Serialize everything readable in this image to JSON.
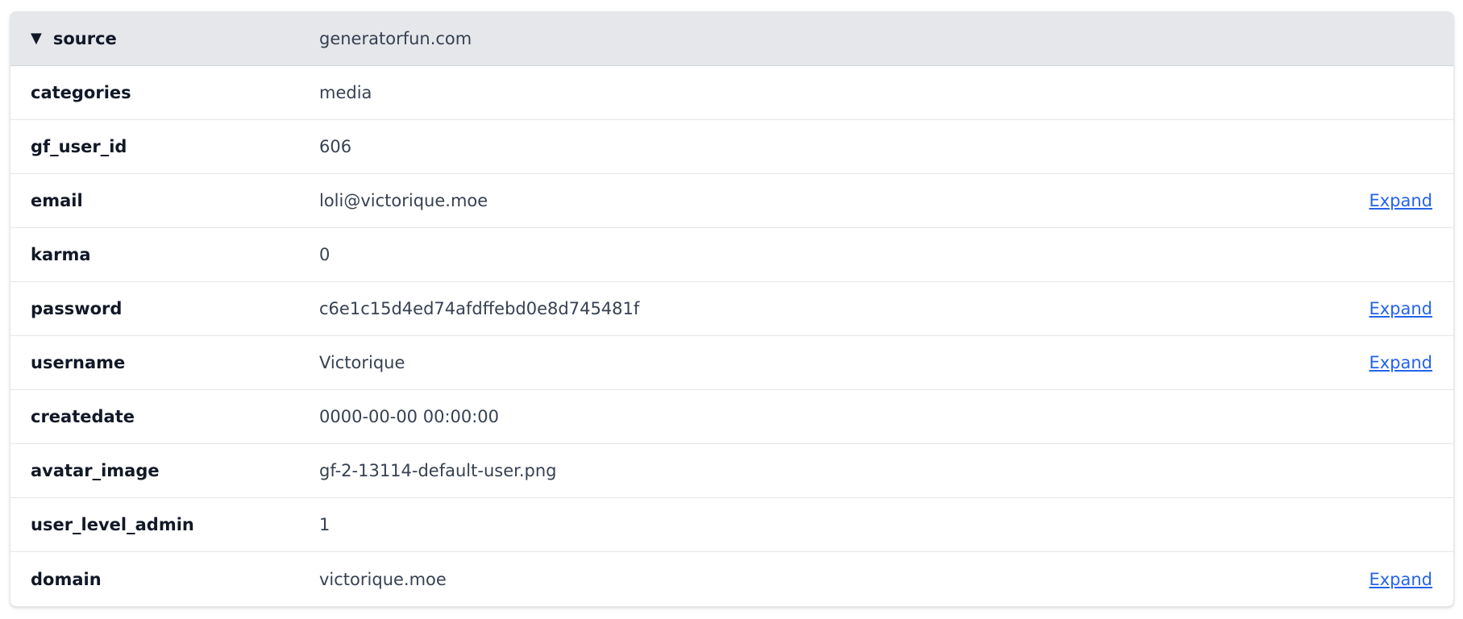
{
  "header": {
    "caret_icon": "▼",
    "key": "source",
    "value": "generatorfun.com"
  },
  "rows": [
    {
      "key": "categories",
      "value": "media",
      "expand": ""
    },
    {
      "key": "gf_user_id",
      "value": "606",
      "expand": ""
    },
    {
      "key": "email",
      "value": "loli@victorique.moe",
      "expand": "Expand"
    },
    {
      "key": "karma",
      "value": "0",
      "expand": ""
    },
    {
      "key": "password",
      "value": "c6e1c15d4ed74afdffebd0e8d745481f",
      "expand": "Expand"
    },
    {
      "key": "username",
      "value": "Victorique",
      "expand": "Expand"
    },
    {
      "key": "createdate",
      "value": "0000-00-00 00:00:00",
      "expand": ""
    },
    {
      "key": "avatar_image",
      "value": "gf-2-13114-default-user.png",
      "expand": ""
    },
    {
      "key": "user_level_admin",
      "value": "1",
      "expand": ""
    },
    {
      "key": "domain",
      "value": "victorique.moe",
      "expand": "Expand"
    }
  ],
  "colors": {
    "header_bg": "#e5e7eb",
    "link": "#2563eb",
    "border": "#e5e7eb"
  }
}
